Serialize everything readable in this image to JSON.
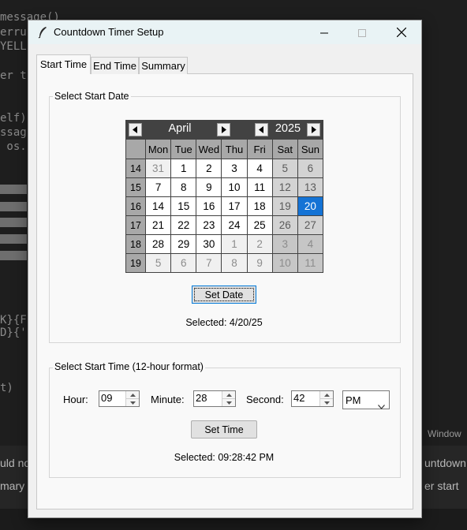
{
  "window": {
    "title": "Countdown Timer Setup",
    "controls": {
      "minimize": "minimize-icon",
      "maximize": "maximize-icon",
      "close": "close-icon"
    }
  },
  "tabs": [
    {
      "label": "Start Time",
      "active": true
    },
    {
      "label": "End Time",
      "active": false
    },
    {
      "label": "Summary",
      "active": false
    }
  ],
  "date_section": {
    "frame_label": "Select Start Date",
    "calendar": {
      "month": "April",
      "year": "2025",
      "weekdays": [
        "Mon",
        "Tue",
        "Wed",
        "Thu",
        "Fri",
        "Sat",
        "Sun"
      ],
      "weeks": [
        {
          "week": "14",
          "days": [
            "31",
            "1",
            "2",
            "3",
            "4",
            "5",
            "6"
          ]
        },
        {
          "week": "15",
          "days": [
            "7",
            "8",
            "9",
            "10",
            "11",
            "12",
            "13"
          ]
        },
        {
          "week": "16",
          "days": [
            "14",
            "15",
            "16",
            "17",
            "18",
            "19",
            "20"
          ]
        },
        {
          "week": "17",
          "days": [
            "21",
            "22",
            "23",
            "24",
            "25",
            "26",
            "27"
          ]
        },
        {
          "week": "18",
          "days": [
            "28",
            "29",
            "30",
            "1",
            "2",
            "3",
            "4"
          ]
        },
        {
          "week": "19",
          "days": [
            "5",
            "6",
            "7",
            "8",
            "9",
            "10",
            "11"
          ]
        }
      ],
      "selected_day": "20",
      "colors": {
        "header_bg": "#424242",
        "selected_bg": "#1473d5",
        "weekend_bg": "#d3d3d3",
        "week_col_bg": "#a8a8a8"
      }
    },
    "set_button": "Set Date",
    "selected_text": "Selected: 4/20/25"
  },
  "time_section": {
    "frame_label": "Select Start Time (12-hour format)",
    "hour_label": "Hour:",
    "hour_value": "09",
    "minute_label": "Minute:",
    "minute_value": "28",
    "second_label": "Second:",
    "second_value": "42",
    "ampm_value": "PM",
    "set_button": "Set Time",
    "selected_text": "Selected: 09:28:42 PM"
  },
  "background": {
    "code_lines": [
      "message()",
      "erru",
      "YELL",
      "er t",
      "elf)",
      "ssag",
      " os.",
      "K}{F",
      "D}{'",
      "t)"
    ],
    "strip_text_left": "uld no",
    "strip_text_left2": "mary",
    "strip_text_right": "untdown",
    "strip_text_right2": "er start",
    "windows_text": "Window"
  }
}
